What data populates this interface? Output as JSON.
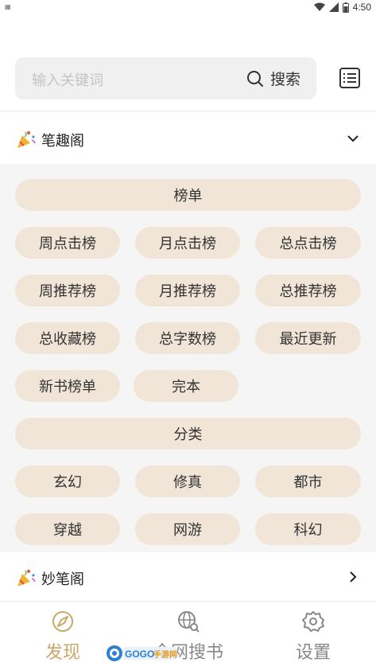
{
  "status": {
    "time": "4:50"
  },
  "search": {
    "placeholder": "输入关键词",
    "button_label": "搜索"
  },
  "groups": [
    {
      "title": "笔趣阁",
      "expanded": true
    },
    {
      "title": "妙笔阁",
      "expanded": false
    }
  ],
  "sections": {
    "ranking": {
      "header": "榜单",
      "items": [
        "周点击榜",
        "月点击榜",
        "总点击榜",
        "周推荐榜",
        "月推荐榜",
        "总推荐榜",
        "总收藏榜",
        "总字数榜",
        "最近更新",
        "新书榜单",
        "完本"
      ]
    },
    "category": {
      "header": "分类",
      "items": [
        "玄幻",
        "修真",
        "都市",
        "穿越",
        "网游",
        "科幻"
      ]
    }
  },
  "nav": {
    "items": [
      {
        "label": "发现",
        "icon": "compass-icon",
        "active": true
      },
      {
        "label": "全网搜书",
        "icon": "globe-search-icon",
        "active": false
      },
      {
        "label": "设置",
        "icon": "gear-icon",
        "active": false
      }
    ]
  },
  "watermark": {
    "text": "GOGO手游网"
  },
  "colors": {
    "accent": "#c9a86a",
    "pill": "#f0e5d6",
    "panel": "#f5f5f5"
  }
}
